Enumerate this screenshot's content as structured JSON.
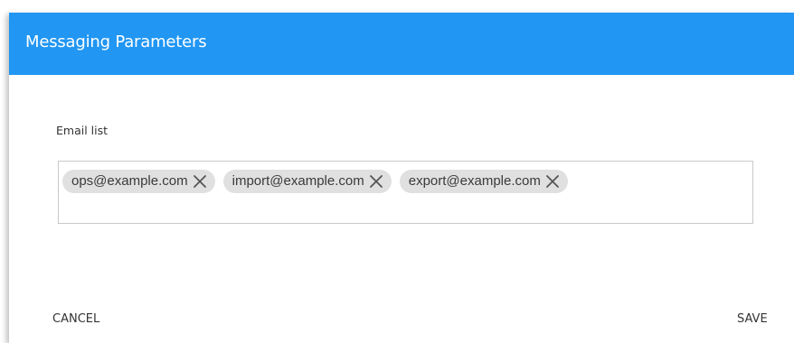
{
  "dialog": {
    "title": "Messaging Parameters",
    "header_color": "#2196f3"
  },
  "email_field": {
    "label": "Email list",
    "chips": [
      {
        "label": "ops@example.com",
        "remove_icon": "close-icon"
      },
      {
        "label": "import@example.com",
        "remove_icon": "close-icon"
      },
      {
        "label": "export@example.com",
        "remove_icon": "close-icon"
      }
    ]
  },
  "actions": {
    "cancel_label": "CANCEL",
    "save_label": "SAVE"
  }
}
